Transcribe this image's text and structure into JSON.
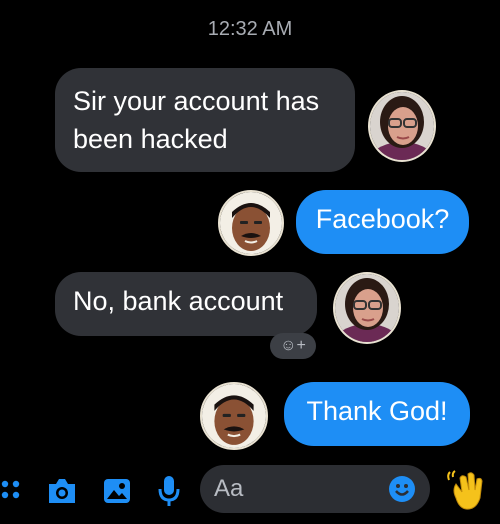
{
  "header": {
    "timestamp": "12:32 AM"
  },
  "messages": [
    {
      "direction": "incoming",
      "text": "Sir your account has been hacked",
      "avatar": "woman-with-glasses"
    },
    {
      "direction": "outgoing",
      "text": "Facebook?",
      "avatar": "man-with-mustache"
    },
    {
      "direction": "incoming",
      "text": "No, bank account",
      "avatar": "woman-with-glasses",
      "reaction": "add-reaction"
    },
    {
      "direction": "outgoing",
      "text": "Thank God!",
      "avatar": "man-with-mustache"
    }
  ],
  "composer": {
    "placeholder": "Aa",
    "icons": [
      "apps-icon",
      "camera-icon",
      "gallery-icon",
      "microphone-icon",
      "emoji-icon",
      "wave-icon"
    ]
  },
  "colors": {
    "background": "#000000",
    "incoming_bubble": "#303237",
    "outgoing_bubble": "#1e8ef5",
    "accent": "#1e8ef5"
  }
}
